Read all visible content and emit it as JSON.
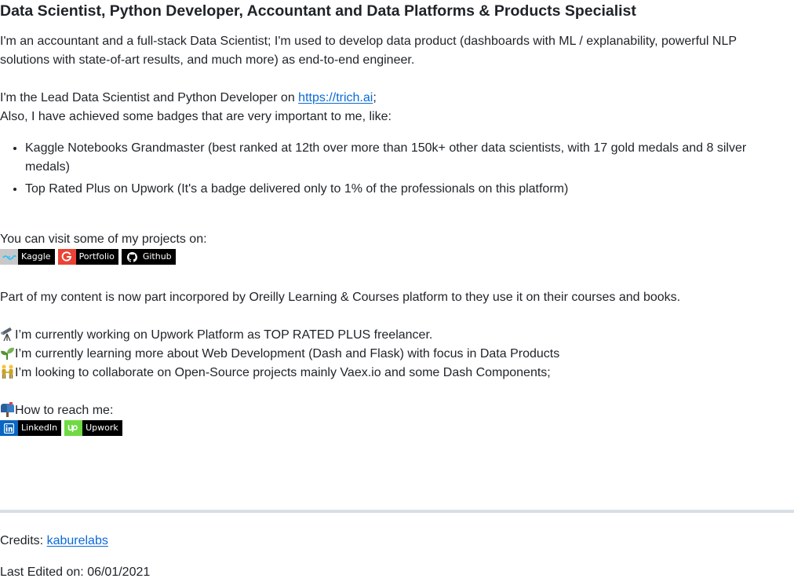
{
  "title": "Data Scientist, Python Developer, Accountant and Data Platforms & Products Specialist",
  "intro": {
    "line1": "I'm an accountant and a full-stack Data Scientist; I'm used to develop data product (dashboards with ML / explanability, powerful NLP",
    "line2": "solutions with state-of-art results, and much more) as end-to-end engineer."
  },
  "lead": {
    "prefix": "I'm the Lead Data Scientist and Python Developer on ",
    "link": "https://trich.ai",
    "suffix": ";"
  },
  "badges_intro": "Also, I have achieved some badges that are very important to me, like:",
  "badges": [
    {
      "line1": "Kaggle Notebooks Grandmaster (best ranked at 12th over more than 150k+ other data scientists, with 17 gold medals and 8 silver",
      "line2": "medals)"
    },
    {
      "line1": "Top Rated Plus on Upwork (It's a badge delivered only to 1% of the professionals on this platform)"
    }
  ],
  "projects_intro": "You can visit some of my projects on:",
  "project_shields": [
    {
      "label": "Kaggle",
      "icon": "kaggle-icon",
      "color": "#20beff"
    },
    {
      "label": "Portfolio",
      "icon": "google-icon",
      "color": "#ea4335"
    },
    {
      "label": "Github",
      "icon": "github-icon",
      "color": "#000000"
    }
  ],
  "oreilly": "Part of my content is now part incorpored by Oreilly Learning & Courses platform to they use it on their courses and books.",
  "status": [
    {
      "icon": "telescope-icon",
      "text": "I’m currently working on Upwork Platform as TOP RATED PLUS freelancer."
    },
    {
      "icon": "seedling-icon",
      "text": "I’m currently learning more about Web Development (Dash and Flask) with focus in Data Products"
    },
    {
      "icon": "people-holding-hands-icon",
      "text": "I’m looking to collaborate on Open-Source projects mainly Vaex.io and some Dash Components;"
    }
  ],
  "reach": {
    "icon": "mailbox-icon",
    "text": "How to reach me:"
  },
  "contact_shields": [
    {
      "label": "LinkedIn",
      "icon": "linkedin-icon",
      "color": "#0a66c2"
    },
    {
      "label": "Upwork",
      "icon": "upwork-icon",
      "color": "#6fda44"
    }
  ],
  "credits": {
    "prefix": "Credits: ",
    "link": "kaburelabs"
  },
  "last_edited": "Last Edited on: 06/01/2021"
}
